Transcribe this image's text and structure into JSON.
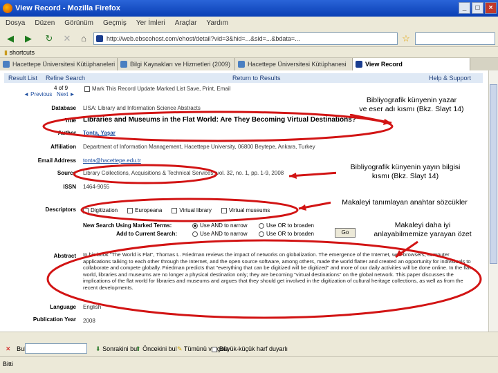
{
  "window": {
    "title": "View Record - Mozilla Firefox",
    "buttons": [
      "_",
      "□",
      "×"
    ]
  },
  "menu": [
    "Dosya",
    "Düzen",
    "Görünüm",
    "Geçmiş",
    "Yer İmleri",
    "Araçlar",
    "Yardım"
  ],
  "nav": {
    "url": "http://web.ebscohost.com/ehost/detail?vid=3&hid=...&sid=...&bdata=...",
    "bookmark_label": "shortcuts"
  },
  "tabs": [
    {
      "label": "Hacettepe Üniversitesi Kütüphaneleri"
    },
    {
      "label": "Bilgi Kaynakları ve Hizmetleri (2009)"
    },
    {
      "label": "Hacettepe Üniversitesi Kütüphanesi"
    },
    {
      "label": "View Record"
    }
  ],
  "record_header": {
    "result_list": "Result List",
    "refine": "Refine Search",
    "back": "Return to Results",
    "help": "Help & Support"
  },
  "record_nav": {
    "position": "4 of 9",
    "previous": "◄ Previous",
    "next": "Next ►",
    "actions": "Mark This Record    Update Marked List    Save, Print, Email"
  },
  "fields": [
    {
      "label": "Database",
      "value": "LISA: Library and Information Science Abstracts"
    },
    {
      "label": "Title",
      "value": "Libraries and Museums in the Flat World: Are They Becoming Virtual Destinations?"
    },
    {
      "label": "Author",
      "value": "Tonta, Yaşar"
    },
    {
      "label": "Affiliation",
      "value": "Department of Information Management, Hacettepe University, 06800 Beytepe, Ankara, Turkey"
    },
    {
      "label": "Email Address",
      "value": "tonta@hacettepe.edu.tr"
    },
    {
      "label": "Source",
      "value": "Library Collections, Acquisitions & Technical Services, vol. 32, no. 1, pp. 1-9, 2008"
    },
    {
      "label": "ISSN",
      "value": "1464-9055"
    },
    {
      "label": "Descriptors",
      "value": ""
    },
    {
      "label": "Abstract",
      "value": ""
    },
    {
      "label": "Language",
      "value": "English"
    },
    {
      "label": "Publication Year",
      "value": "2008"
    }
  ],
  "descriptors": [
    "Digitization",
    "Europeana",
    "Virtual library",
    "Virtual museums"
  ],
  "search_opts": {
    "new_search": "New Search Using Marked Terms:",
    "add_to_search": "Add to Current Search:",
    "and": "Use AND to narrow",
    "or": "Use OR to broaden",
    "go": "Go"
  },
  "abstract_text": "In his book \"The World is Flat\", Thomas L. Friedman reviews the impact of networks on globalization. The emergence of the Internet, web browsers, computer applications talking to each other through the Internet, and the open source software, among others, made the world flatter and created an opportunity for individuals to collaborate and compete globally. Friedman predicts that \"everything that can be digitized will be digitized\" and more of our daily activities will be done online. In the flat world, libraries and museums are no longer a physical destination only; they are becoming \"virtual destinations\" on the global network. This paper discusses the implications of the flat world for libraries and museums and argues that they should get involved in the digitization of cultural heritage collections, as well as from the recent developments.",
  "findbar": {
    "label": "Bul:",
    "next": "Sonrakini bul",
    "prev": "Öncekini bul",
    "highlight": "Tümünü vurgula",
    "match_case": "Büyük-küçük harf duyarlı"
  },
  "status": "Bitti",
  "callouts": {
    "c1": "Bibliyografik künyenin yazar\nve eser adı kısmı (Bkz. Slayt 14)",
    "c2": "Bibliyografik künyenin yayın bilgisi\nkısmı (Bkz. Slayt 14)",
    "c3": "Makaleyi tanımlayan anahtar sözcükler",
    "c4": "Makaleyi daha iyi\nanlayabilmemize yarayan özet"
  },
  "colors": {
    "annotation": "#d21414",
    "titlebar": "#0a3fb4"
  }
}
